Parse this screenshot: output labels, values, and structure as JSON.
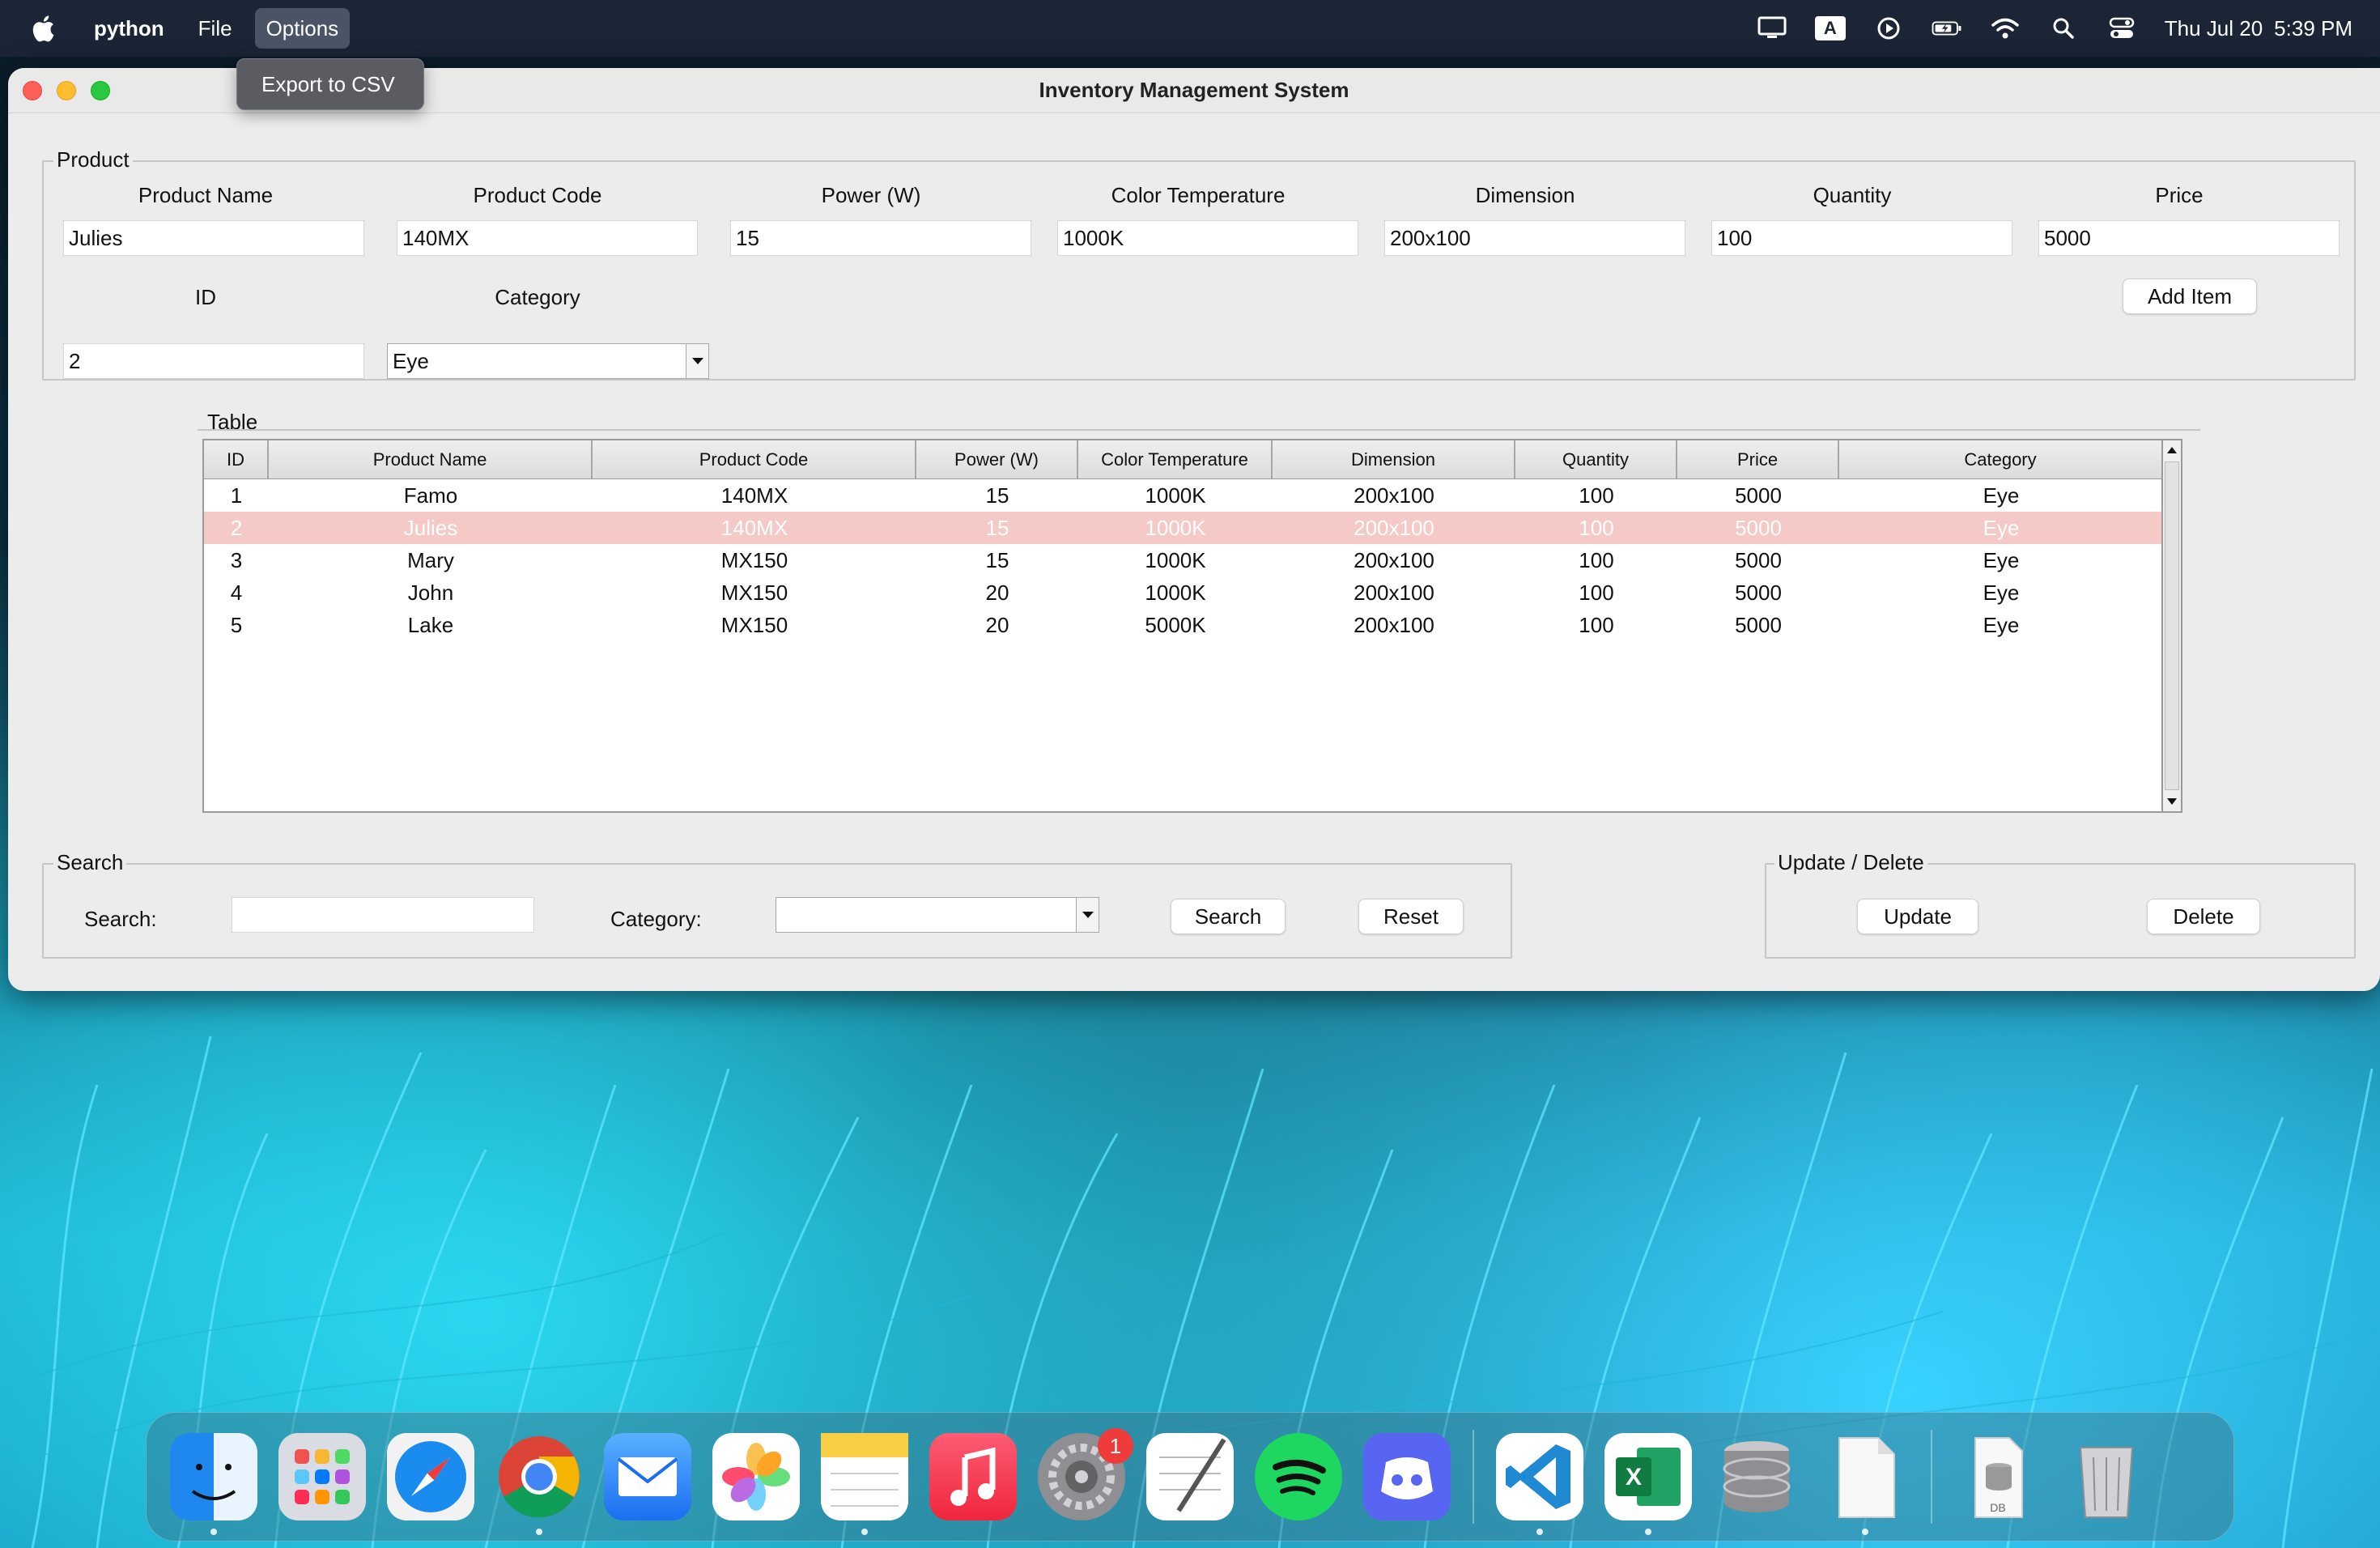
{
  "menubar": {
    "app_name": "python",
    "menus": [
      "File",
      "Options"
    ],
    "active_menu": "Options",
    "status_icons": [
      "display-icon",
      "input-source-icon",
      "play-icon",
      "battery-icon",
      "wifi-icon",
      "search-icon",
      "control-center-icon"
    ],
    "input_source_letter": "A",
    "date": "Thu Jul 20",
    "time": "5:39 PM"
  },
  "options_menu": {
    "items": [
      "Export to CSV"
    ]
  },
  "window": {
    "title": "Inventory Management System",
    "product": {
      "group_label": "Product",
      "labels": {
        "product_name": "Product Name",
        "product_code": "Product Code",
        "power": "Power (W)",
        "color_temp": "Color Temperature",
        "dimension": "Dimension",
        "quantity": "Quantity",
        "price": "Price",
        "id": "ID",
        "category": "Category"
      },
      "values": {
        "product_name": "Julies",
        "product_code": "140MX",
        "power": "15",
        "color_temp": "1000K",
        "dimension": "200x100",
        "quantity": "100",
        "price": "5000",
        "id": "2",
        "category": "Eye"
      },
      "add_button": "Add Item"
    },
    "table": {
      "group_label": "Table",
      "columns": [
        "ID",
        "Product Name",
        "Product Code",
        "Power (W)",
        "Color Temperature",
        "Dimension",
        "Quantity",
        "Price",
        "Category"
      ],
      "rows": [
        [
          "1",
          "Famo",
          "140MX",
          "15",
          "1000K",
          "200x100",
          "100",
          "5000",
          "Eye"
        ],
        [
          "2",
          "Julies",
          "140MX",
          "15",
          "1000K",
          "200x100",
          "100",
          "5000",
          "Eye"
        ],
        [
          "3",
          "Mary",
          "MX150",
          "15",
          "1000K",
          "200x100",
          "100",
          "5000",
          "Eye"
        ],
        [
          "4",
          "John",
          "MX150",
          "20",
          "1000K",
          "200x100",
          "100",
          "5000",
          "Eye"
        ],
        [
          "5",
          "Lake",
          "MX150",
          "20",
          "5000K",
          "200x100",
          "100",
          "5000",
          "Eye"
        ]
      ],
      "selected_row": 1
    },
    "search": {
      "group_label": "Search",
      "search_label": "Search:",
      "search_value": "",
      "category_label": "Category:",
      "category_value": "",
      "search_button": "Search",
      "reset_button": "Reset"
    },
    "update_delete": {
      "group_label": "Update / Delete",
      "update_button": "Update",
      "delete_button": "Delete"
    }
  },
  "dock": {
    "apps": [
      "finder-icon",
      "launchpad-icon",
      "safari-icon",
      "chrome-icon",
      "mail-icon",
      "photos-icon",
      "notes-icon",
      "music-icon",
      "system-settings-icon",
      "textedit-icon",
      "spotify-icon",
      "discord-icon",
      "vscode-icon",
      "excel-icon",
      "database-icon",
      "document-icon",
      "db-file-icon",
      "trash-icon"
    ],
    "settings_badge": "1",
    "db_file_label": "DB"
  }
}
